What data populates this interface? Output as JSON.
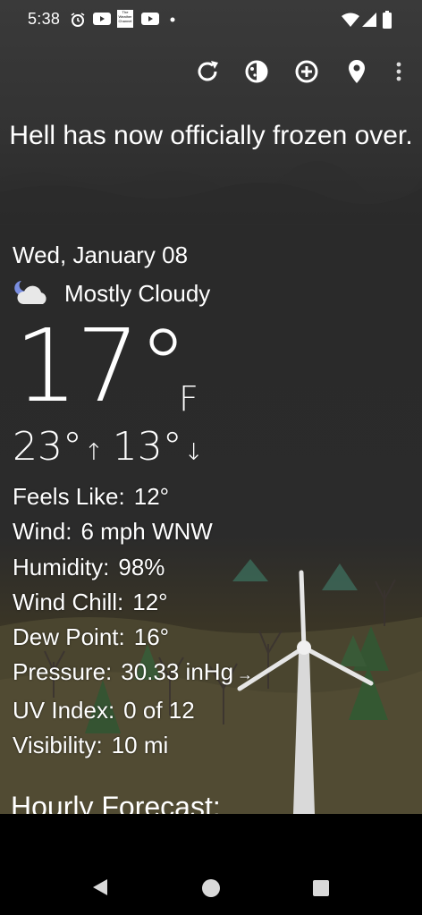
{
  "status_bar": {
    "time": "5:38",
    "icons": [
      "alarm-icon",
      "youtube-icon",
      "weather-channel-icon",
      "youtube-icon",
      "dot-icon",
      "wifi-icon",
      "signal-icon",
      "battery-icon"
    ],
    "weather_channel_badge": "The Weather Channel"
  },
  "toolbar": {
    "icons": [
      "refresh-icon",
      "theme-icon",
      "add-location-icon",
      "location-pin-icon",
      "more-vert-icon"
    ]
  },
  "headline": "Hell has now officially frozen over.",
  "current": {
    "date": "Wed, January 08",
    "condition": "Mostly Cloudy",
    "condition_icon": "partly-cloudy-night-icon",
    "temperature": "17°",
    "unit": "F",
    "high": "23°",
    "low": "13°",
    "high_arrow": "↑",
    "low_arrow": "↓"
  },
  "details": [
    {
      "label": "Feels Like:",
      "value": "12°"
    },
    {
      "label": "Wind:",
      "value": "6 mph WNW"
    },
    {
      "label": "Humidity:",
      "value": "98%"
    },
    {
      "label": "Wind Chill:",
      "value": "12°"
    },
    {
      "label": "Dew Point:",
      "value": "16°"
    },
    {
      "label": "Pressure:",
      "value": "30.33 inHg"
    },
    {
      "label": "UV Index:",
      "value": "0 of 12"
    },
    {
      "label": "Visibility:",
      "value": "10 mi"
    }
  ],
  "pressure_trend": "→",
  "hourly_heading": "Hourly Forecast:",
  "nav": {
    "icons": [
      "back-icon",
      "home-icon",
      "recents-icon"
    ]
  }
}
